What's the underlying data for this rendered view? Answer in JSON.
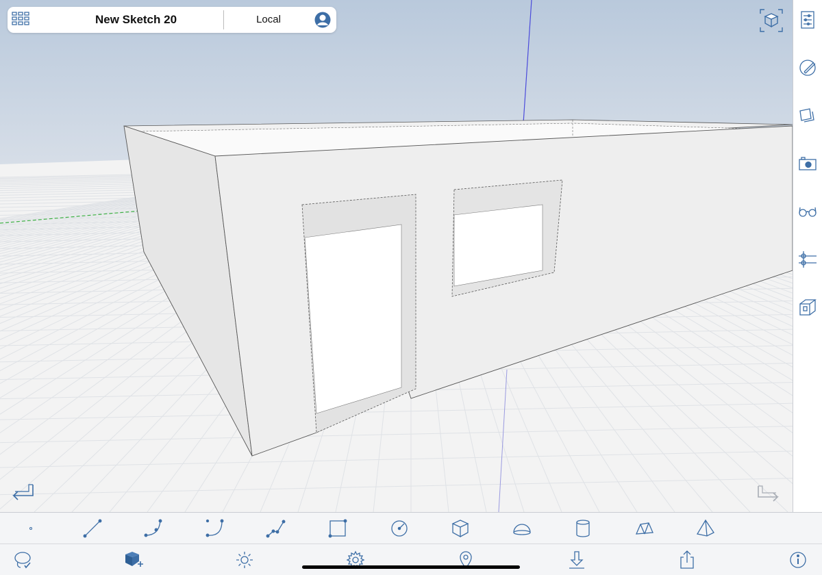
{
  "header": {
    "title": "New Sketch 20",
    "location": "Local",
    "icons": {
      "menu": "grid-menu-icon",
      "account": "user-account-icon"
    }
  },
  "viewport": {
    "view_cube_icon": "view-cube-icon",
    "undo_icon": "undo-arrow-icon",
    "redo_icon": "redo-arrow-icon",
    "colors": {
      "accent": "#3d6ea6",
      "grid": "#dfe2e6",
      "sky_top": "#b9c9dc",
      "wall": "#ececec"
    }
  },
  "right_sidebar": {
    "items": [
      {
        "icon": "object-info-icon"
      },
      {
        "icon": "paint-materials-icon"
      },
      {
        "icon": "layers-icon"
      },
      {
        "icon": "scenes-camera-icon"
      },
      {
        "icon": "view-glasses-icon"
      },
      {
        "icon": "guides-icon"
      },
      {
        "icon": "section-plane-icon"
      }
    ]
  },
  "draw_toolbar": {
    "items": [
      {
        "icon": "point-tool-icon"
      },
      {
        "icon": "line-tool-icon"
      },
      {
        "icon": "arc-tool-icon"
      },
      {
        "icon": "curve-tool-icon"
      },
      {
        "icon": "polyline-tool-icon"
      },
      {
        "icon": "rectangle-tool-icon"
      },
      {
        "icon": "circle-tool-icon"
      },
      {
        "icon": "box-tool-icon"
      },
      {
        "icon": "dome-tool-icon"
      },
      {
        "icon": "cylinder-tool-icon"
      },
      {
        "icon": "prism-tool-icon"
      },
      {
        "icon": "pyramid-tool-icon"
      }
    ]
  },
  "bottom_toolbar": {
    "items": [
      {
        "icon": "select-lasso-icon"
      },
      {
        "icon": "add-object-icon"
      },
      {
        "icon": "lighting-sun-icon"
      },
      {
        "icon": "settings-gear-icon"
      },
      {
        "icon": "location-pin-icon"
      },
      {
        "icon": "import-download-icon"
      },
      {
        "icon": "share-export-icon"
      },
      {
        "icon": "info-icon"
      }
    ]
  }
}
